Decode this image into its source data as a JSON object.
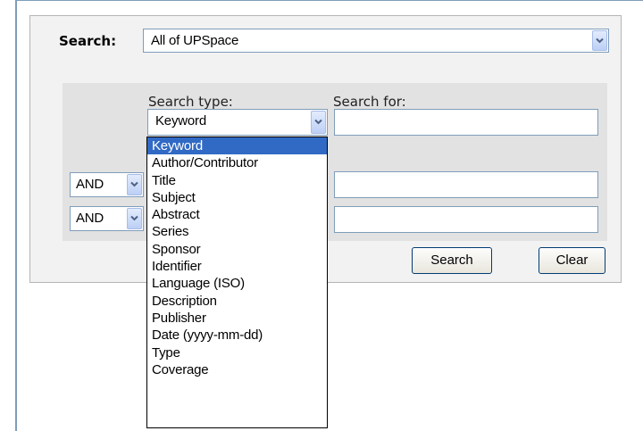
{
  "search": {
    "label": "Search:",
    "scope_value": "All of UPSpace"
  },
  "query": {
    "search_type_header": "Search type:",
    "search_for_header": "Search for:",
    "row1_type_value": "Keyword",
    "row2_conjunction": "AND",
    "row3_conjunction": "AND"
  },
  "dropdown": {
    "selected_index": 0,
    "options": [
      "Keyword",
      "Author/Contributor",
      "Title",
      "Subject",
      "Abstract",
      "Series",
      "Sponsor",
      "Identifier",
      "Language (ISO)",
      "Description",
      "Publisher",
      "Date (yyyy-mm-dd)",
      "Type",
      "Coverage"
    ]
  },
  "buttons": {
    "search_label": "Search",
    "clear_label": "Clear"
  },
  "colors": {
    "selection": "#316ac5",
    "input_border": "#7f9db9",
    "panel_bg": "#f2f2f2",
    "query_area_bg": "#e2e2e2"
  },
  "icons": {
    "dropdown_arrow": "chevron-down-icon"
  }
}
